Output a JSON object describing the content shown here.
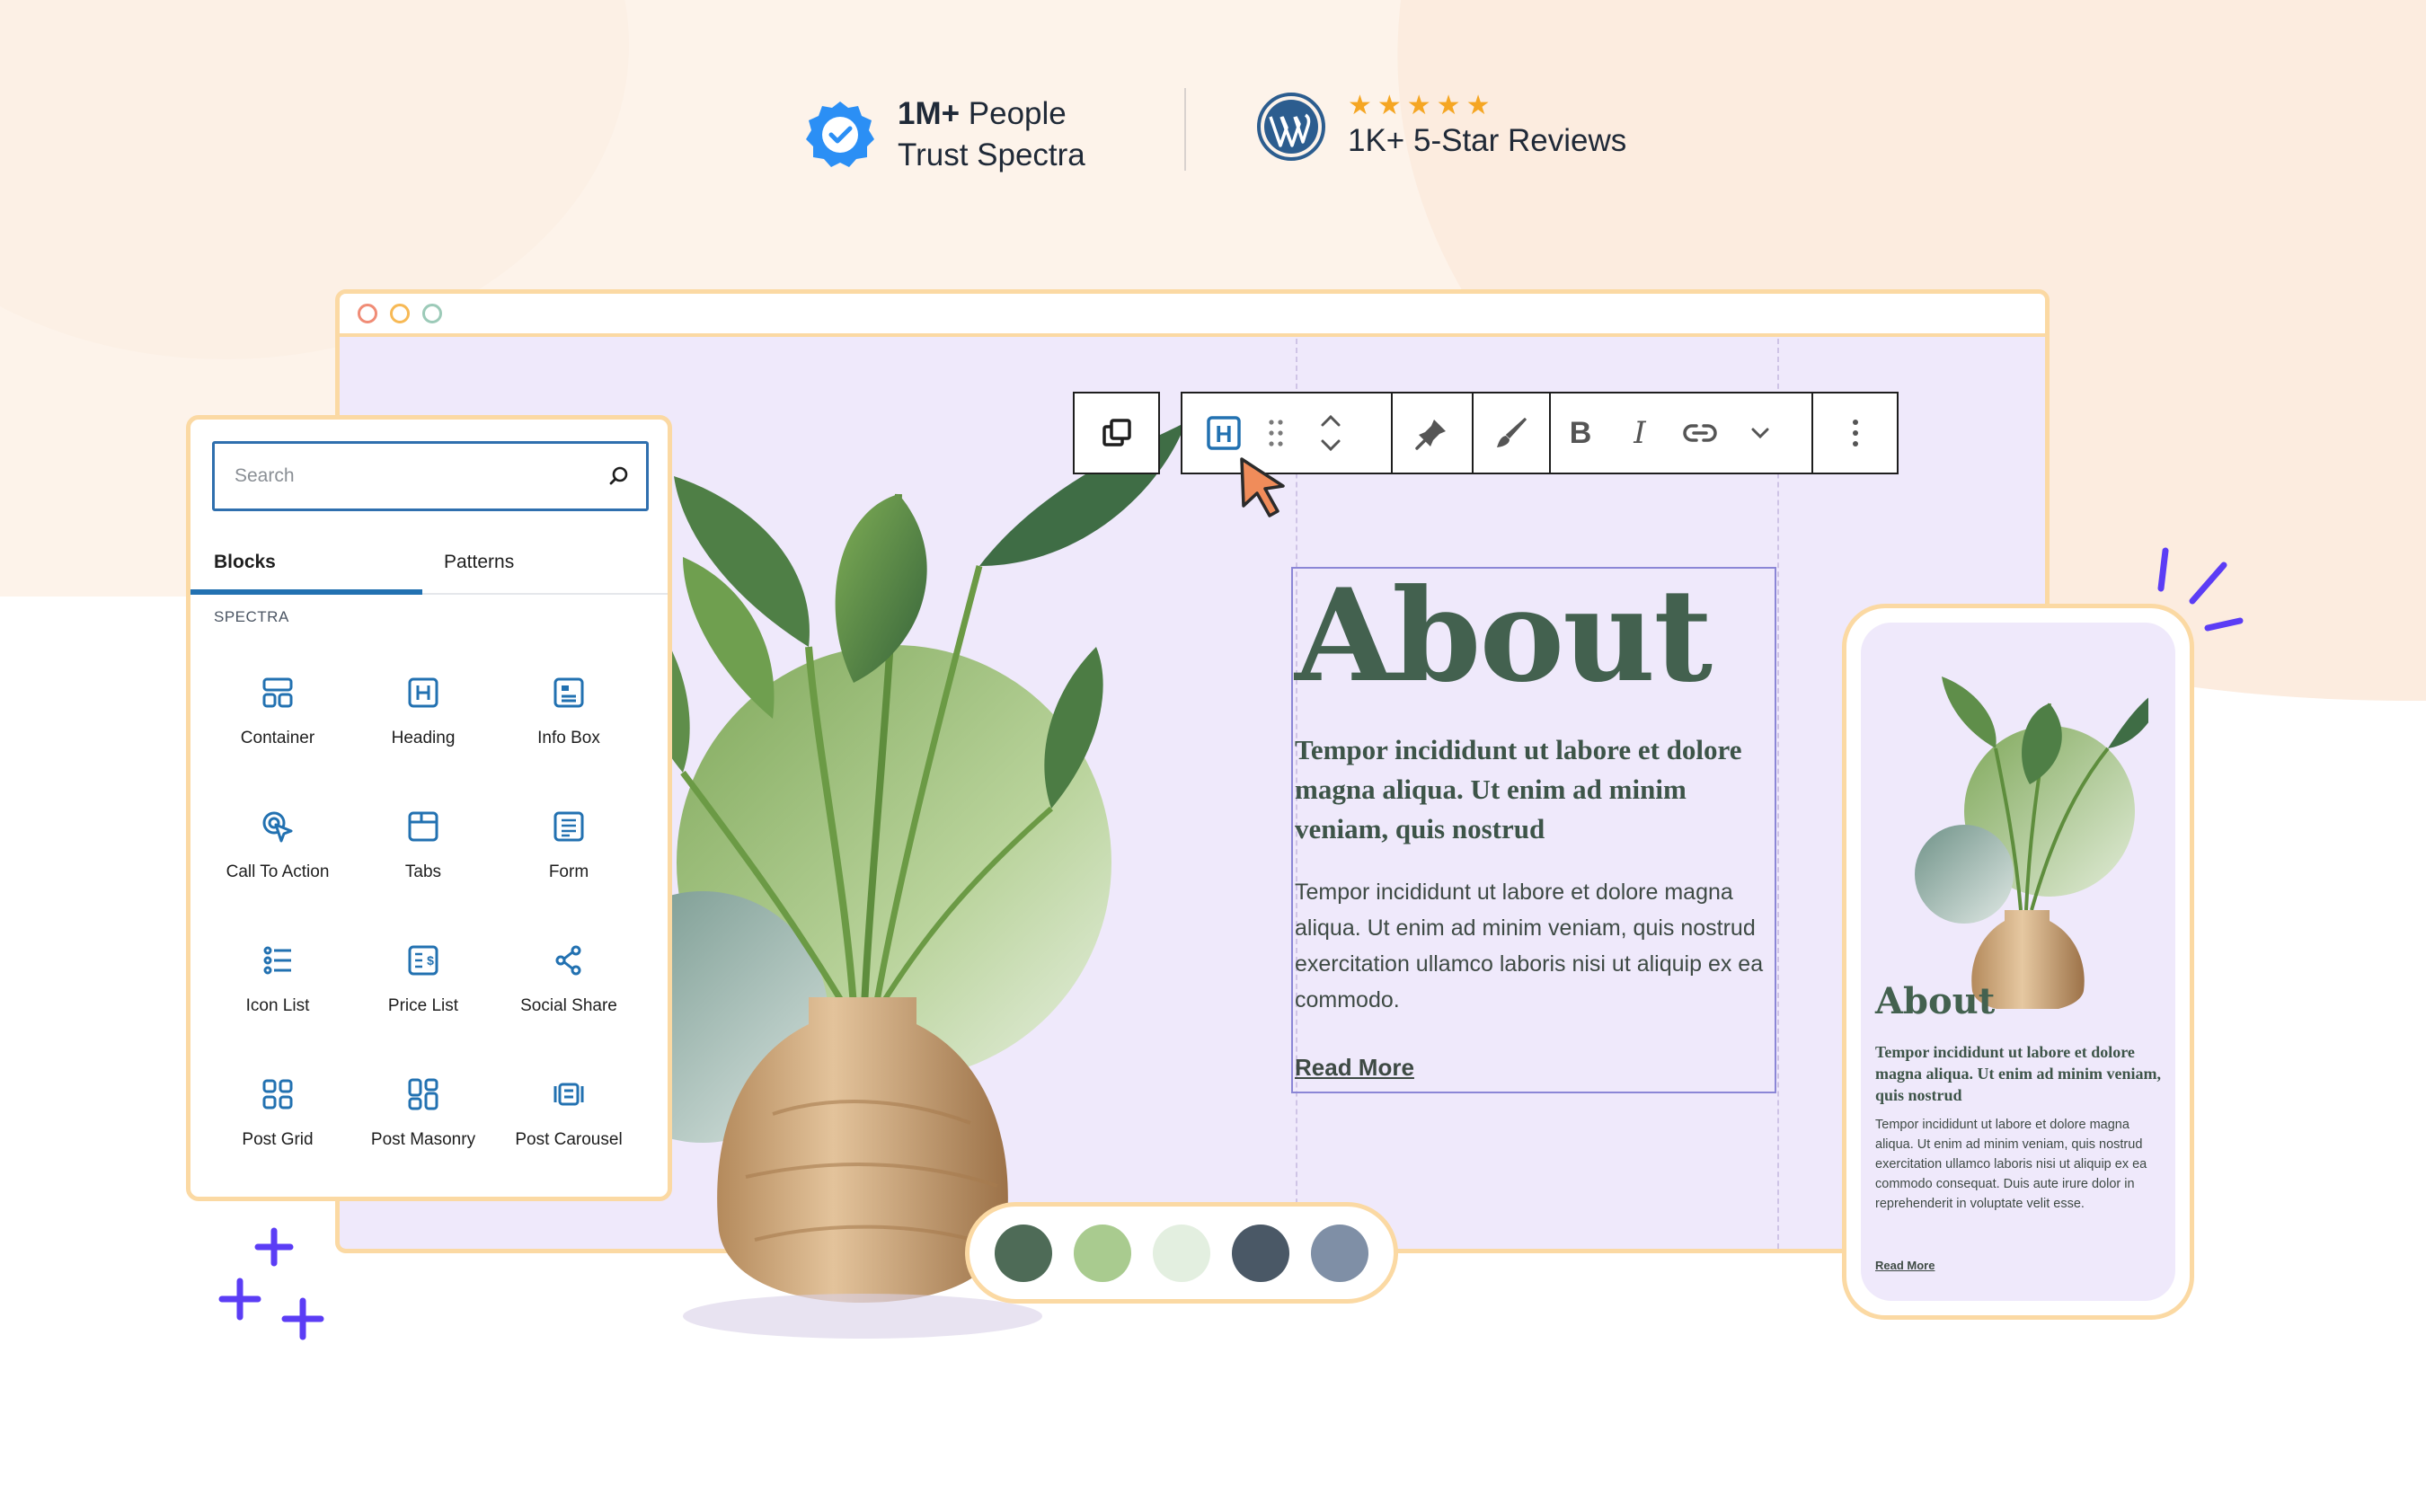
{
  "trust": {
    "people_bold": "1M+",
    "people_rest": " People",
    "people_line2": "Trust Spectra",
    "stars": "★★★★★",
    "reviews_label": "1K+ 5-Star Reviews"
  },
  "inserter": {
    "search_placeholder": "Search",
    "tabs": [
      {
        "label": "Blocks",
        "active": true
      },
      {
        "label": "Patterns",
        "active": false
      }
    ],
    "section_label": "SPECTRA",
    "blocks": [
      {
        "label": "Container",
        "icon": "container-icon"
      },
      {
        "label": "Heading",
        "icon": "heading-icon"
      },
      {
        "label": "Info Box",
        "icon": "info-box-icon"
      },
      {
        "label": "Call To Action",
        "icon": "call-to-action-icon"
      },
      {
        "label": "Tabs",
        "icon": "tabs-icon"
      },
      {
        "label": "Form",
        "icon": "form-icon"
      },
      {
        "label": "Icon List",
        "icon": "icon-list-icon"
      },
      {
        "label": "Price List",
        "icon": "price-list-icon"
      },
      {
        "label": "Social Share",
        "icon": "social-share-icon"
      },
      {
        "label": "Post Grid",
        "icon": "post-grid-icon"
      },
      {
        "label": "Post Masonry",
        "icon": "post-masonry-icon"
      },
      {
        "label": "Post Carousel",
        "icon": "post-carousel-icon"
      }
    ]
  },
  "toolbar": {
    "items": [
      "duplicate-icon",
      "heading-block-icon",
      "drag-handle-icon",
      "move-up-down-icon",
      "pin-icon",
      "brush-icon",
      "bold-icon",
      "italic-icon",
      "link-icon",
      "chevron-down-icon",
      "more-options-icon"
    ],
    "bold_glyph": "B",
    "italic_glyph": "I",
    "heading_glyph": "H"
  },
  "content": {
    "heading": "About",
    "subheading": "Tempor incididunt ut labore et dolore magna aliqua. Ut enim ad minim veniam, quis nostrud",
    "body": "Tempor incididunt ut labore et dolore magna aliqua. Ut enim ad minim veniam, quis nostrud exercitation ullamco laboris nisi ut aliquip ex ea commodo.",
    "read_more": "Read More"
  },
  "palette": {
    "colors": [
      "#4e6b57",
      "#a9cb8f",
      "#e3efe0",
      "#4a5866",
      "#7f8fa6"
    ]
  },
  "mobile": {
    "heading": "About",
    "subheading": "Tempor incididunt ut labore et dolore magna aliqua. Ut enim ad minim veniam, quis nostrud",
    "body": "Tempor incididunt ut labore et dolore magna aliqua. Ut enim ad minim veniam, quis nostrud exercitation ullamco laboris nisi ut aliquip ex ea commodo consequat. Duis aute irure dolor in reprehenderit in voluptate velit esse.",
    "read_more": "Read More"
  },
  "colors": {
    "accent_blue": "#2271b1",
    "frame_orange": "#fbd9a3",
    "heading_green": "#43614f",
    "canvas_lavender": "#efe9fb",
    "sparkle_purple": "#5b3df5"
  }
}
